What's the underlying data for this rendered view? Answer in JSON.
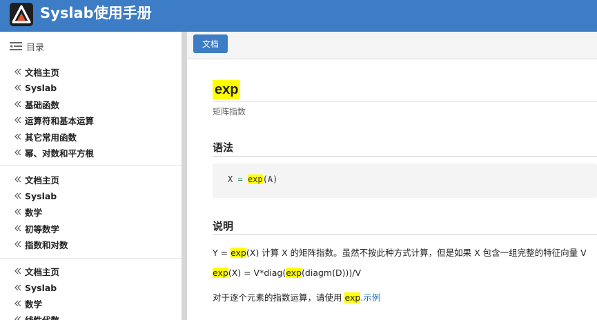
{
  "header": {
    "app_title": "Syslab使用手册"
  },
  "sidebar": {
    "toc_label": "目录",
    "groups": [
      [
        "文档主页",
        "Syslab",
        "基础函数",
        "运算符和基本运算",
        "其它常用函数",
        "幂、对数和平方根"
      ],
      [
        "文档主页",
        "Syslab",
        "数学",
        "初等数学",
        "指数和对数"
      ],
      [
        "文档主页",
        "Syslab",
        "数学",
        "线性代数"
      ]
    ]
  },
  "main": {
    "tab_label": "文档",
    "function_name": "exp",
    "subtitle": "矩阵指数",
    "syntax_heading": "语法",
    "syntax": {
      "lhs": "X",
      "op": "=",
      "fn": "exp",
      "args": "(A)"
    },
    "desc_heading": "说明",
    "desc1": {
      "pre": "Y = ",
      "fn": "exp",
      "post": "(X) 计算 X 的矩阵指数。虽然不按此种方式计算，但是如果 X 包含一组完整的特征向量 V"
    },
    "desc2": {
      "fn1": "exp",
      "mid": "(X) = V*diag(",
      "fn2": "exp",
      "post": "(diagm(D)))/V"
    },
    "desc3": {
      "pre": "对于逐个元素的指数运算，请使用 ",
      "fn": "exp",
      "link": ".示例"
    }
  }
}
